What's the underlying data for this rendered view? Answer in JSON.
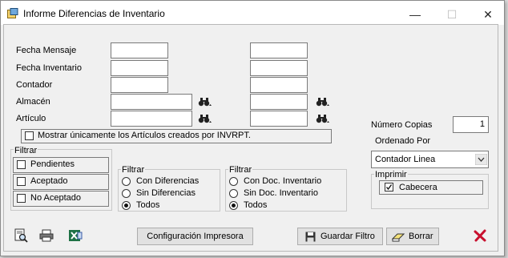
{
  "window": {
    "title": "Informe Diferencias de Inventario",
    "controls": {
      "minimize": "—",
      "maximize": "☐",
      "close": "✕"
    }
  },
  "fields": {
    "fecha_mensaje": {
      "label": "Fecha Mensaje",
      "value_from": "",
      "value_to": ""
    },
    "fecha_inventario": {
      "label": "Fecha Inventario",
      "value_from": "",
      "value_to": ""
    },
    "contador": {
      "label": "Contador",
      "value_from": "",
      "value_to": ""
    },
    "almacen": {
      "label": "Almacén",
      "value_from": "",
      "value_to": ""
    },
    "articulo": {
      "label": "Artículo",
      "value_from": "",
      "value_to": ""
    }
  },
  "only_invrpt": {
    "label": "Mostrar únicamente los Artículos creados por INVRPT.",
    "checked": false
  },
  "filtrar_estado": {
    "title": "Filtrar",
    "items": [
      {
        "label": "Pendientes",
        "checked": false
      },
      {
        "label": "Aceptado",
        "checked": false
      },
      {
        "label": "No Aceptado",
        "checked": false
      }
    ]
  },
  "filtrar_diferencias": {
    "title": "Filtrar",
    "options": [
      "Con Diferencias",
      "Sin Diferencias",
      "Todos"
    ],
    "selected": "Todos"
  },
  "filtrar_doc": {
    "title": "Filtrar",
    "options": [
      "Con Doc. Inventario",
      "Sin Doc. Inventario",
      "Todos"
    ],
    "selected": "Todos"
  },
  "numero_copias": {
    "label": "Número Copias",
    "value": "1"
  },
  "ordenado_por": {
    "label": "Ordenado Por",
    "selected": "Contador Linea"
  },
  "imprimir": {
    "title": "Imprimir",
    "cabecera_label": "Cabecera",
    "cabecera_checked": true
  },
  "buttons": {
    "config_impresora": "Configuración Impresora",
    "guardar_filtro": "Guardar Filtro",
    "borrar": "Borrar"
  },
  "colors": {
    "close_x": "#c8102e",
    "excel_green": "#1e7145",
    "titlebar": "#ffffff"
  }
}
